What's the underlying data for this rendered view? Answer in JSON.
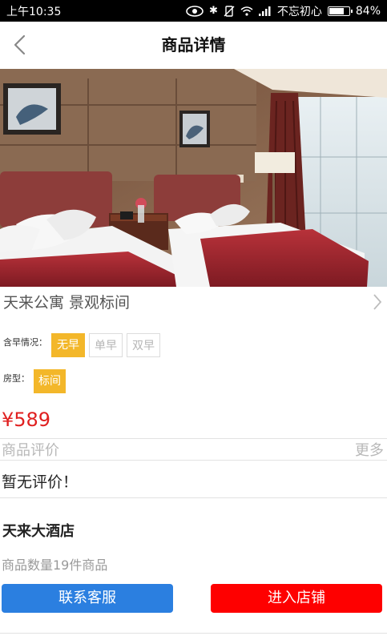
{
  "status_bar": {
    "time": "上午10:35",
    "carrier": "不忘初心",
    "battery_text": "84%",
    "battery_level": 0.84,
    "icons": [
      "eye-icon",
      "bluetooth-icon",
      "vibrate-off-icon",
      "wifi-icon",
      "signal-icon",
      "battery-icon"
    ]
  },
  "header": {
    "title": "商品详情",
    "back_icon": "chevron-left-icon"
  },
  "product": {
    "name": "天来公寓 景观标间",
    "image": "hotel-room-photo"
  },
  "options": {
    "breakfast": {
      "label": "含早情况：",
      "choices": [
        "无早",
        "单早",
        "双早"
      ],
      "selected": "无早"
    },
    "room_type": {
      "label": "房型：",
      "choices": [
        "标间"
      ],
      "selected": "标间"
    }
  },
  "price": "¥589",
  "reviews": {
    "title": "商品评价",
    "more": "更多",
    "empty_text": "暂无评价！"
  },
  "store": {
    "name": "天来大酒店",
    "product_count": "商品数量19件商品"
  },
  "actions": {
    "contact": "联系客服",
    "enter": "进入店铺"
  },
  "colors": {
    "accent_chip": "#f3b72a",
    "price": "#e02020",
    "contact_btn": "#2b7fe0",
    "enter_btn": "#fe0000"
  }
}
